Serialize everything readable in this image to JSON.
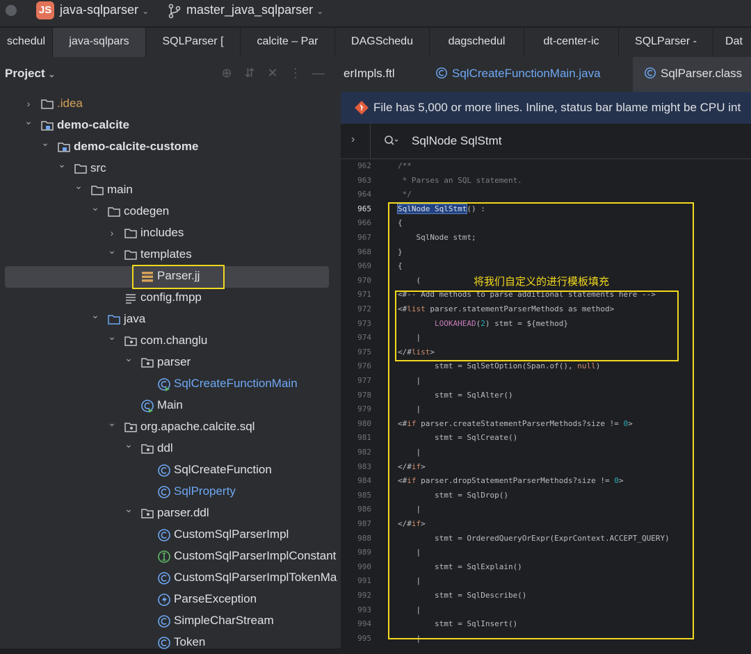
{
  "titlebar": {
    "project_badge": "JS",
    "project_name": "java-sqlparser",
    "branch": "master_java_sqlparser",
    "icons": [
      "window-close-dot",
      "chevron-down-icon",
      "branch-icon"
    ]
  },
  "editor_tabs": [
    {
      "label": "schedul",
      "w": 76
    },
    {
      "label": "java-sqlpars",
      "w": 134
    },
    {
      "label": "SQLParser [",
      "w": 136
    },
    {
      "label": "calcite – Par",
      "w": 136
    },
    {
      "label": "DAGSchedu",
      "w": 136
    },
    {
      "label": "dagschedul",
      "w": 136
    },
    {
      "label": "dt-center-ic",
      "w": 136
    },
    {
      "label": "SQLParser -",
      "w": 136
    },
    {
      "label": "Dat",
      "w": 60
    }
  ],
  "project_panel": {
    "title": "Project",
    "tree": [
      {
        "label": ".idea",
        "icon": "folder",
        "color": "orange"
      },
      {
        "label": "demo-calcite",
        "icon": "module",
        "bold": true
      },
      {
        "label": "demo-calcite-custome",
        "icon": "module",
        "bold": true
      },
      {
        "label": "src",
        "icon": "folder"
      },
      {
        "label": "main",
        "icon": "folder"
      },
      {
        "label": "codegen",
        "icon": "folder"
      },
      {
        "label": "includes",
        "icon": "folder"
      },
      {
        "label": "templates",
        "icon": "folder"
      },
      {
        "label": "Parser.jj",
        "icon": "jj-file"
      },
      {
        "label": "config.fmpp",
        "icon": "text-file"
      },
      {
        "label": "java",
        "icon": "source-folder"
      },
      {
        "label": "com.changlu",
        "icon": "package"
      },
      {
        "label": "parser",
        "icon": "package"
      },
      {
        "label": "SqlCreateFunctionMain",
        "icon": "main-class",
        "color": "blue"
      },
      {
        "label": "Main",
        "icon": "main-class"
      },
      {
        "label": "org.apache.calcite.sql",
        "icon": "package"
      },
      {
        "label": "ddl",
        "icon": "package"
      },
      {
        "label": "SqlCreateFunction",
        "icon": "class"
      },
      {
        "label": "SqlProperty",
        "icon": "class",
        "color": "blue"
      },
      {
        "label": "parser.ddl",
        "icon": "package"
      },
      {
        "label": "CustomSqlParserImpl",
        "icon": "class"
      },
      {
        "label": "CustomSqlParserImplConstant",
        "icon": "interface"
      },
      {
        "label": "CustomSqlParserImplTokenMa",
        "icon": "class"
      },
      {
        "label": "ParseException",
        "icon": "exception"
      },
      {
        "label": "SimpleCharStream",
        "icon": "class"
      },
      {
        "label": "Token",
        "icon": "class"
      }
    ]
  },
  "file_tabs": [
    {
      "label": "erImpls.ftl"
    },
    {
      "label": "SqlCreateFunctionMain.java"
    },
    {
      "label": "SqlParser.class"
    }
  ],
  "banner": {
    "text": "File has 5,000 or more lines. Inline, status bar blame might be CPU int"
  },
  "search": {
    "text": "SqlNode SqlStmt"
  },
  "annotation": "将我们自定义的进行模板填充",
  "code_lines": [
    {
      "n": "962",
      "t": "/**"
    },
    {
      "n": "963",
      "t": " * Parses an SQL statement."
    },
    {
      "n": "964",
      "t": " */"
    },
    {
      "n": "965",
      "t": "SqlNode SqlStmt() :"
    },
    {
      "n": "966",
      "t": "{"
    },
    {
      "n": "967",
      "t": "    SqlNode stmt;"
    },
    {
      "n": "968",
      "t": "}"
    },
    {
      "n": "969",
      "t": "{"
    },
    {
      "n": "970",
      "t": "    ("
    },
    {
      "n": "971",
      "t": "<#-- Add methods to parse additional statements here -->"
    },
    {
      "n": "972",
      "t": "<#list parser.statementParserMethods as method>"
    },
    {
      "n": "973",
      "t": "        LOOKAHEAD(2) stmt = ${method}"
    },
    {
      "n": "974",
      "t": "    |"
    },
    {
      "n": "975",
      "t": "</#list>"
    },
    {
      "n": "976",
      "t": "        stmt = SqlSetOption(Span.of(), null)"
    },
    {
      "n": "977",
      "t": "    |"
    },
    {
      "n": "978",
      "t": "        stmt = SqlAlter()"
    },
    {
      "n": "979",
      "t": "    |"
    },
    {
      "n": "980",
      "t": "<#if parser.createStatementParserMethods?size != 0>"
    },
    {
      "n": "981",
      "t": "        stmt = SqlCreate()"
    },
    {
      "n": "982",
      "t": "    |"
    },
    {
      "n": "983",
      "t": "</#if>"
    },
    {
      "n": "984",
      "t": "<#if parser.dropStatementParserMethods?size != 0>"
    },
    {
      "n": "985",
      "t": "        stmt = SqlDrop()"
    },
    {
      "n": "986",
      "t": "    |"
    },
    {
      "n": "987",
      "t": "</#if>"
    },
    {
      "n": "988",
      "t": "        stmt = OrderedQueryOrExpr(ExprContext.ACCEPT_QUERY)"
    },
    {
      "n": "989",
      "t": "    |"
    },
    {
      "n": "990",
      "t": "        stmt = SqlExplain()"
    },
    {
      "n": "991",
      "t": "    |"
    },
    {
      "n": "992",
      "t": "        stmt = SqlDescribe()"
    },
    {
      "n": "993",
      "t": "    |"
    },
    {
      "n": "994",
      "t": "        stmt = SqlInsert()"
    },
    {
      "n": "995",
      "t": "    |"
    }
  ],
  "colors": {
    "highlight_box": "#f2d91f",
    "link_blue": "#6fa8f4",
    "selection": "#214283"
  }
}
